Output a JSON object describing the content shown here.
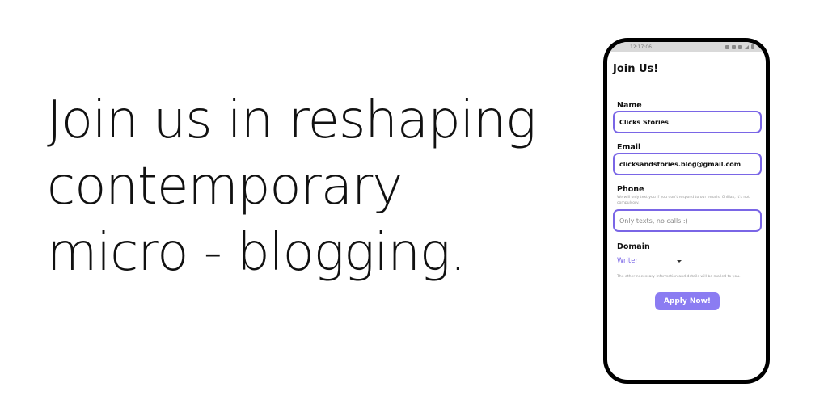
{
  "headline": {
    "line1": "Join us in reshaping",
    "line2": "contemporary",
    "line3": "micro - blogging."
  },
  "phone": {
    "statusbar": {
      "time": "12:17:06"
    },
    "app": {
      "title": "Join Us!",
      "name": {
        "label": "Name",
        "value": "Clicks Stories"
      },
      "email": {
        "label": "Email",
        "value": "clicksandstories.blog@gmail.com"
      },
      "phone": {
        "label": "Phone",
        "hint": "We will only text you if you don't respond to our emails. Chillax, it's not compulsory.",
        "placeholder": "Only texts, no calls :)"
      },
      "domain": {
        "label": "Domain",
        "selected": "Writer"
      },
      "footer_note": "The other necessary information and details will be mailed to you.",
      "apply_label": "Apply Now!"
    }
  },
  "colors": {
    "accent": "#7a66e6",
    "button": "#8b7cf2"
  }
}
